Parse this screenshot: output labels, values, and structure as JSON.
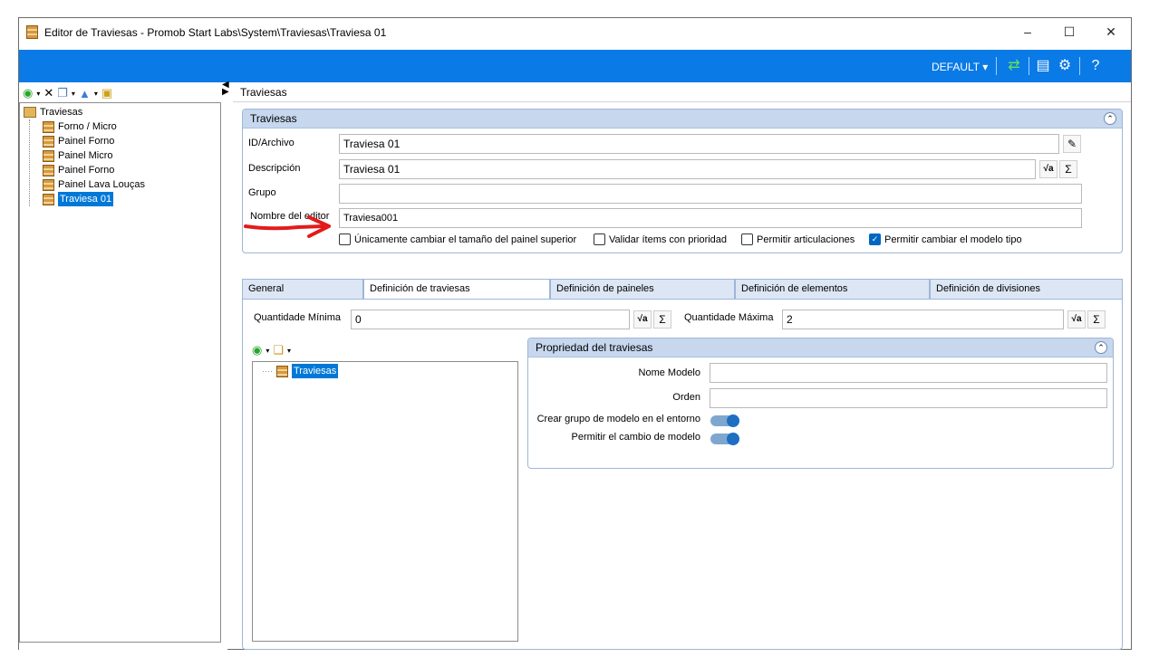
{
  "window": {
    "title": "Editor de Traviesas - Promob Start Labs\\System\\Traviesas\\Traviesa 01",
    "controls": [
      "–",
      "☐",
      "✕"
    ]
  },
  "ribbon": {
    "profile": "DEFAULT",
    "accent": "#0a7ae6"
  },
  "left_tree": {
    "root": "Traviesas",
    "items": [
      "Forno / Micro",
      "Painel Forno",
      "Painel Micro",
      "Painel Forno",
      "Painel Lava Louças",
      "Traviesa 01"
    ],
    "selected": "Traviesa 01"
  },
  "breadcrumb": "Traviesas",
  "traviesas_group": {
    "title": "Traviesas",
    "id_label": "ID/Archivo",
    "id_value": "Traviesa 01",
    "desc_label": "Descripción",
    "desc_value": "Traviesa 01",
    "group_label": "Grupo",
    "group_value": "",
    "editor_label": "Nombre del editor",
    "editor_value": "Traviesa001",
    "checks": [
      {
        "label": "Únicamente cambiar el tamaño del painel superior",
        "checked": false
      },
      {
        "label": "Validar ítems con prioridad",
        "checked": false
      },
      {
        "label": "Permitir articulaciones",
        "checked": false
      },
      {
        "label": "Permitir cambiar el modelo tipo",
        "checked": true
      }
    ]
  },
  "tabs": [
    "General",
    "Definición de traviesas",
    "Definición de paineles",
    "Definición de elementos",
    "Definición de divisiones"
  ],
  "active_tab": "Definición de traviesas",
  "tab_content": {
    "min_label": "Quantidade Mínima",
    "min_value": "0",
    "max_label": "Quantidade Máxima",
    "max_value": "2",
    "inner_tree_root": "Traviesas",
    "props_title": "Propriedad del traviesas",
    "model_name_label": "Nome Modelo",
    "model_name_value": "",
    "order_label": "Orden",
    "order_value": "",
    "toggle1_label": "Crear grupo de modelo en el entorno",
    "toggle1_on": true,
    "toggle2_label": "Permitir el cambio de modelo",
    "toggle2_on": true
  },
  "icons": {
    "sqrt": "√a",
    "sum": "Σ",
    "collapse": "⌃",
    "arrow_color": "#e31b1b"
  }
}
